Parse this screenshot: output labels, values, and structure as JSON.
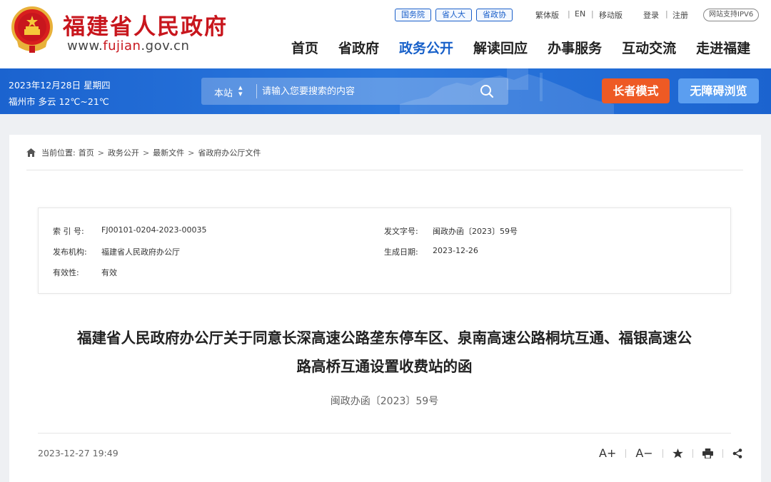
{
  "header": {
    "site_title": "福建省人民政府",
    "site_url_prefix": "www.",
    "site_url_brand": "fujian",
    "site_url_suffix": ".gov.cn",
    "top_pills": [
      "国务院",
      "省人大",
      "省政协"
    ],
    "lang_links": [
      "繁体版",
      "EN",
      "移动版"
    ],
    "auth_links": [
      "登录",
      "注册"
    ],
    "ipv6": "网站支持IPV6",
    "nav": [
      {
        "label": "首页",
        "active": false
      },
      {
        "label": "省政府",
        "active": false
      },
      {
        "label": "政务公开",
        "active": true
      },
      {
        "label": "解读回应",
        "active": false
      },
      {
        "label": "办事服务",
        "active": false
      },
      {
        "label": "互动交流",
        "active": false
      },
      {
        "label": "走进福建",
        "active": false
      }
    ]
  },
  "bar": {
    "date": "2023年12月28日 星期四",
    "weather": "福州市 多云 12℃~21℃",
    "search_scope": "本站",
    "search_placeholder": "请输入您要搜索的内容",
    "elder_mode": "长者模式",
    "accessible": "无障碍浏览"
  },
  "breadcrumb": {
    "prefix": "当前位置:",
    "items": [
      "首页",
      "政务公开",
      "最新文件",
      "省政府办公厅文件"
    ]
  },
  "meta": {
    "index_label": "索 引 号:",
    "index_value": "FJ00101-0204-2023-00035",
    "docno_label": "发文字号:",
    "docno_value": "闽政办函〔2023〕59号",
    "issuer_label": "发布机构:",
    "issuer_value": "福建省人民政府办公厅",
    "date_label": "生成日期:",
    "date_value": "2023-12-26",
    "valid_label": "有效性:",
    "valid_value": "有效"
  },
  "document": {
    "title_line1": "福建省人民政府办公厅关于同意长深高速公路垄东停车区、泉南高速公路桐坑互通、福银高速公",
    "title_line2": "路高桥互通设置收费站的函",
    "doc_number": "闽政办函〔2023〕59号",
    "publish_time": "2023-12-27 19:49",
    "font_increase": "A+",
    "font_decrease": "A−"
  },
  "icons": {
    "emblem": "national-emblem-icon",
    "search": "search-icon",
    "home": "home-icon",
    "favorite": "star-icon",
    "print": "printer-icon",
    "share": "share-icon"
  },
  "colors": {
    "brand_red": "#c8161d",
    "nav_active": "#1760c9",
    "bar_blue": "#1b63cf",
    "elder_orange": "#ee5a24",
    "access_blue": "#5b9ef0"
  }
}
